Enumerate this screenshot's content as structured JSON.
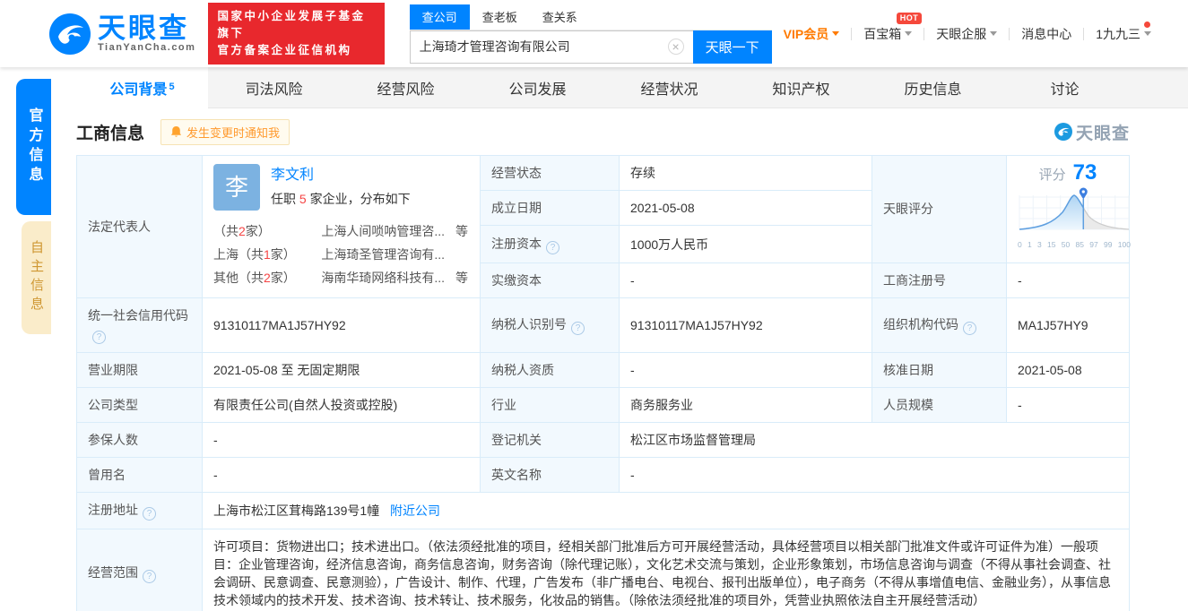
{
  "header": {
    "logo": {
      "title": "天眼查",
      "subtitle": "TianYanCha.com"
    },
    "badge_line1": "国家中小企业发展子基金旗下",
    "badge_line2": "官方备案企业征信机构",
    "search": {
      "tabs": [
        {
          "label": "查公司"
        },
        {
          "label": "查老板"
        },
        {
          "label": "查关系"
        }
      ],
      "input_value": "上海琦才管理咨询有限公司",
      "button_label": "天眼一下"
    },
    "nav": {
      "vip": "VIP会员",
      "treasure": "百宝箱",
      "hot": "HOT",
      "qifu": "天眼企服",
      "messages": "消息中心",
      "username": "1九九三"
    }
  },
  "side_tabs": {
    "official": "官方信息",
    "self": "自主信息"
  },
  "tabs": [
    {
      "label": "公司背景",
      "count": "5"
    },
    {
      "label": "司法风险"
    },
    {
      "label": "经营风险"
    },
    {
      "label": "公司发展"
    },
    {
      "label": "经营状况"
    },
    {
      "label": "知识产权"
    },
    {
      "label": "历史信息"
    },
    {
      "label": "讨论"
    }
  ],
  "section": {
    "title": "工商信息",
    "notify_button": "发生变更时通知我",
    "watermark": "天眼查"
  },
  "biz": {
    "legal_rep": {
      "label": "法定代表人",
      "avatar_char": "李",
      "name": "李文利",
      "tenure_pre": "任职 ",
      "tenure_count": "5",
      "tenure_post": " 家企业，分布如下",
      "distribution": [
        {
          "region_pre": "（共",
          "count": "2",
          "region_post": "家）",
          "company": "上海人间唢呐管理咨...",
          "suffix": "等"
        },
        {
          "region_pre": "上海（共",
          "count": "1",
          "region_post": "家）",
          "company": "上海琦圣管理咨询有...",
          "suffix": ""
        },
        {
          "region_pre": "其他（共",
          "count": "2",
          "region_post": "家）",
          "company": "海南华琦网络科技有...",
          "suffix": "等"
        }
      ]
    },
    "fields": {
      "status_label": "经营状态",
      "status": "存续",
      "established_label": "成立日期",
      "established": "2021-05-08",
      "reg_capital_label": "注册资本",
      "reg_capital": "1000万人民币",
      "paid_capital_label": "实缴资本",
      "paid_capital": "-",
      "score_label": "天眼评分",
      "reg_no_label": "工商注册号",
      "reg_no": "-",
      "credit_code_label": "统一社会信用代码",
      "credit_code": "91310117MA1J57HY92",
      "taxpayer_id_label": "纳税人识别号",
      "taxpayer_id": "91310117MA1J57HY92",
      "org_code_label": "组织机构代码",
      "org_code": "MA1J57HY9",
      "term_label": "营业期限",
      "term": "2021-05-08 至 无固定期限",
      "taxpayer_quality_label": "纳税人资质",
      "taxpayer_quality": "-",
      "approval_date_label": "核准日期",
      "approval_date": "2021-05-08",
      "company_type_label": "公司类型",
      "company_type": "有限责任公司(自然人投资或控股)",
      "industry_label": "行业",
      "industry": "商务服务业",
      "staff_size_label": "人员规模",
      "staff_size": "-",
      "insured_label": "参保人数",
      "insured": "-",
      "registry_label": "登记机关",
      "registry": "松江区市场监督管理局",
      "former_name_label": "曾用名",
      "former_name": "-",
      "english_name_label": "英文名称",
      "english_name": "-",
      "address_label": "注册地址",
      "address": "上海市松江区茸梅路139号1幢",
      "address_link": "附近公司",
      "scope_label": "经营范围",
      "scope": "许可项目：货物进出口；技术进出口。（依法须经批准的项目，经相关部门批准后方可开展经营活动，具体经营项目以相关部门批准文件或许可证件为准）一般项目：企业管理咨询，经济信息咨询，商务信息咨询，财务咨询（除代理记账），文化艺术交流与策划，企业形象策划，市场信息咨询与调查（不得从事社会调查、社会调研、民意调查、民意测验），广告设计、制作、代理，广告发布（非广播电台、电视台、报刊出版单位），电子商务（不得从事增值电信、金融业务），从事信息技术领域内的技术开发、技术咨询、技术转让、技术服务，化妆品的销售。（除依法须经批准的项目外，凭营业执照依法自主开展经营活动）"
    },
    "score_chart": {
      "label": "评分",
      "value": "73",
      "ticks": [
        "0",
        "1",
        "3",
        "15",
        "50",
        "85",
        "97",
        "99",
        "100"
      ]
    }
  },
  "colors": {
    "primary_blue": "#0084ff",
    "badge_red": "#e8282d",
    "vip_orange": "#ff7a00",
    "table_border": "#d9ecf9"
  }
}
